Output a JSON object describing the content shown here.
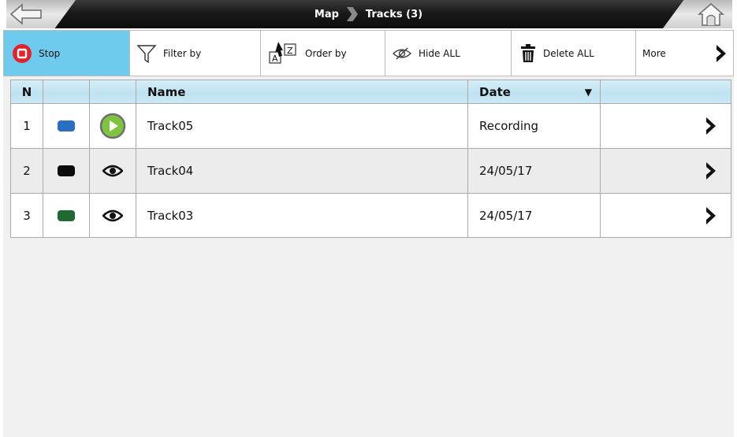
{
  "header": {
    "breadcrumb": [
      "Map",
      "Tracks (3)"
    ]
  },
  "toolbar": {
    "stop_label": "Stop",
    "filter_label": "Filter by",
    "order_label": "Order by",
    "hide_label": "Hide ALL",
    "delete_label": "Delete ALL",
    "more_label": "More"
  },
  "table": {
    "columns": [
      "N",
      "",
      "",
      "Name",
      "Date",
      ""
    ],
    "sort_indicator": "▼",
    "rows": [
      {
        "n": "1",
        "color": "#2a6fc0",
        "visibility": "play-icon",
        "name": "Track05",
        "date": "Recording"
      },
      {
        "n": "2",
        "color": "#0a0a0a",
        "visibility": "eye-icon",
        "name": "Track04",
        "date": "24/05/17"
      },
      {
        "n": "3",
        "color": "#1e6a32",
        "visibility": "eye-icon",
        "name": "Track03",
        "date": "24/05/17"
      }
    ]
  },
  "colors": {
    "accent": "#6fcbee",
    "header_gradient": "#bfe2f2",
    "stop_red": "#e3232b",
    "play_green": "#7fc441"
  }
}
